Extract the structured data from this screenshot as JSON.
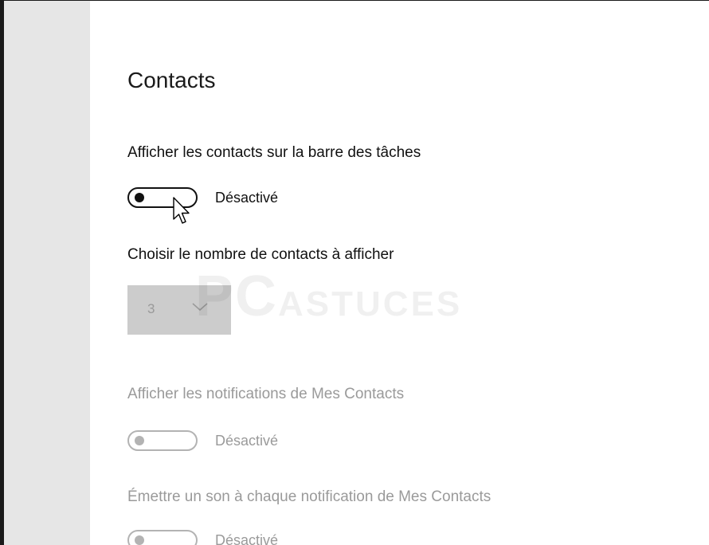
{
  "section": {
    "title": "Contacts"
  },
  "settings": {
    "show_on_taskbar": {
      "label": "Afficher les contacts sur la barre des tâches",
      "state": "Désactivé"
    },
    "contact_count": {
      "label": "Choisir le nombre de contacts à afficher",
      "value": "3"
    },
    "notifications": {
      "label": "Afficher les notifications de Mes Contacts",
      "state": "Désactivé"
    },
    "sound": {
      "label": "Émettre un son à chaque notification de Mes Contacts",
      "state": "Désactivé"
    }
  },
  "watermark": {
    "text_pc": "PC",
    "text_astuces": "ASTUCES"
  },
  "colors": {
    "sidebar": "#e6e6e6",
    "disabled_text": "#9a9a9a",
    "select_bg": "#cccccc"
  },
  "icons": {
    "cursor": "arrow-pointer-icon",
    "chevron": "chevron-down-icon"
  }
}
